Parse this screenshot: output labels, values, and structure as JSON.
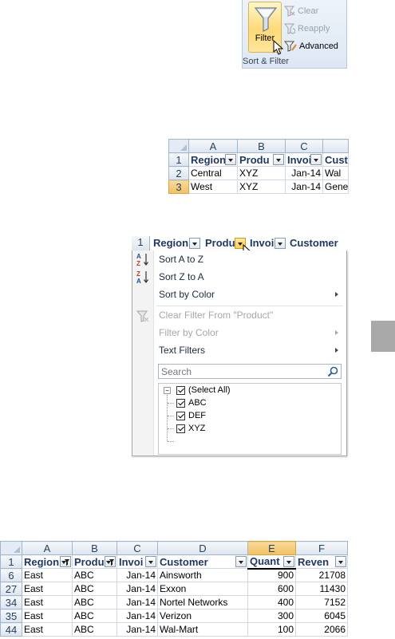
{
  "ribbon": {
    "filter_label": "Filter",
    "clear_label": "Clear",
    "reapply_label": "Reapply",
    "advanced_label": "Advanced",
    "group_title": "Sort & Filter",
    "accent": "#ffd977"
  },
  "small_sheet": {
    "columns": [
      "A",
      "B",
      "C"
    ],
    "header_row": "1",
    "headers": [
      "Region",
      "Produ",
      "Invoi",
      "Cust"
    ],
    "rows": [
      {
        "num": "2",
        "region": "Central",
        "product": "XYZ",
        "date": "Jan-14",
        "customer": "Wal"
      },
      {
        "num": "3",
        "region": "West",
        "product": "XYZ",
        "date": "Jan-14",
        "customer": "Gene"
      }
    ]
  },
  "filter_menu": {
    "header_row": "1",
    "headers": [
      "Region",
      "Produ",
      "Invoi",
      "Customer"
    ],
    "sort_az": "Sort A to Z",
    "sort_za": "Sort Z to A",
    "sort_by_color": "Sort by Color",
    "clear_filter": "Clear Filter From \"Product\"",
    "filter_by_color": "Filter by Color",
    "text_filters": "Text Filters",
    "search_placeholder": "Search",
    "options": [
      "(Select All)",
      "ABC",
      "DEF",
      "XYZ"
    ]
  },
  "result_sheet": {
    "columns": [
      "A",
      "B",
      "C",
      "D",
      "E",
      "F"
    ],
    "header_row": "1",
    "headers": [
      "Region",
      "Produ",
      "Invoi",
      "Customer",
      "Quant",
      "Reven"
    ],
    "rows": [
      {
        "num": "6",
        "region": "East",
        "product": "ABC",
        "date": "Jan-14",
        "customer": "Ainsworth",
        "quantity": "900",
        "revenue": "21708"
      },
      {
        "num": "27",
        "region": "East",
        "product": "ABC",
        "date": "Jan-14",
        "customer": "Exxon",
        "quantity": "600",
        "revenue": "11430"
      },
      {
        "num": "34",
        "region": "East",
        "product": "ABC",
        "date": "Jan-14",
        "customer": "Nortel Networks",
        "quantity": "400",
        "revenue": "7152"
      },
      {
        "num": "35",
        "region": "East",
        "product": "ABC",
        "date": "Jan-14",
        "customer": "Verizon",
        "quantity": "300",
        "revenue": "6045"
      },
      {
        "num": "44",
        "region": "East",
        "product": "ABC",
        "date": "Jan-14",
        "customer": "Wal-Mart",
        "quantity": "100",
        "revenue": "2066"
      }
    ]
  }
}
